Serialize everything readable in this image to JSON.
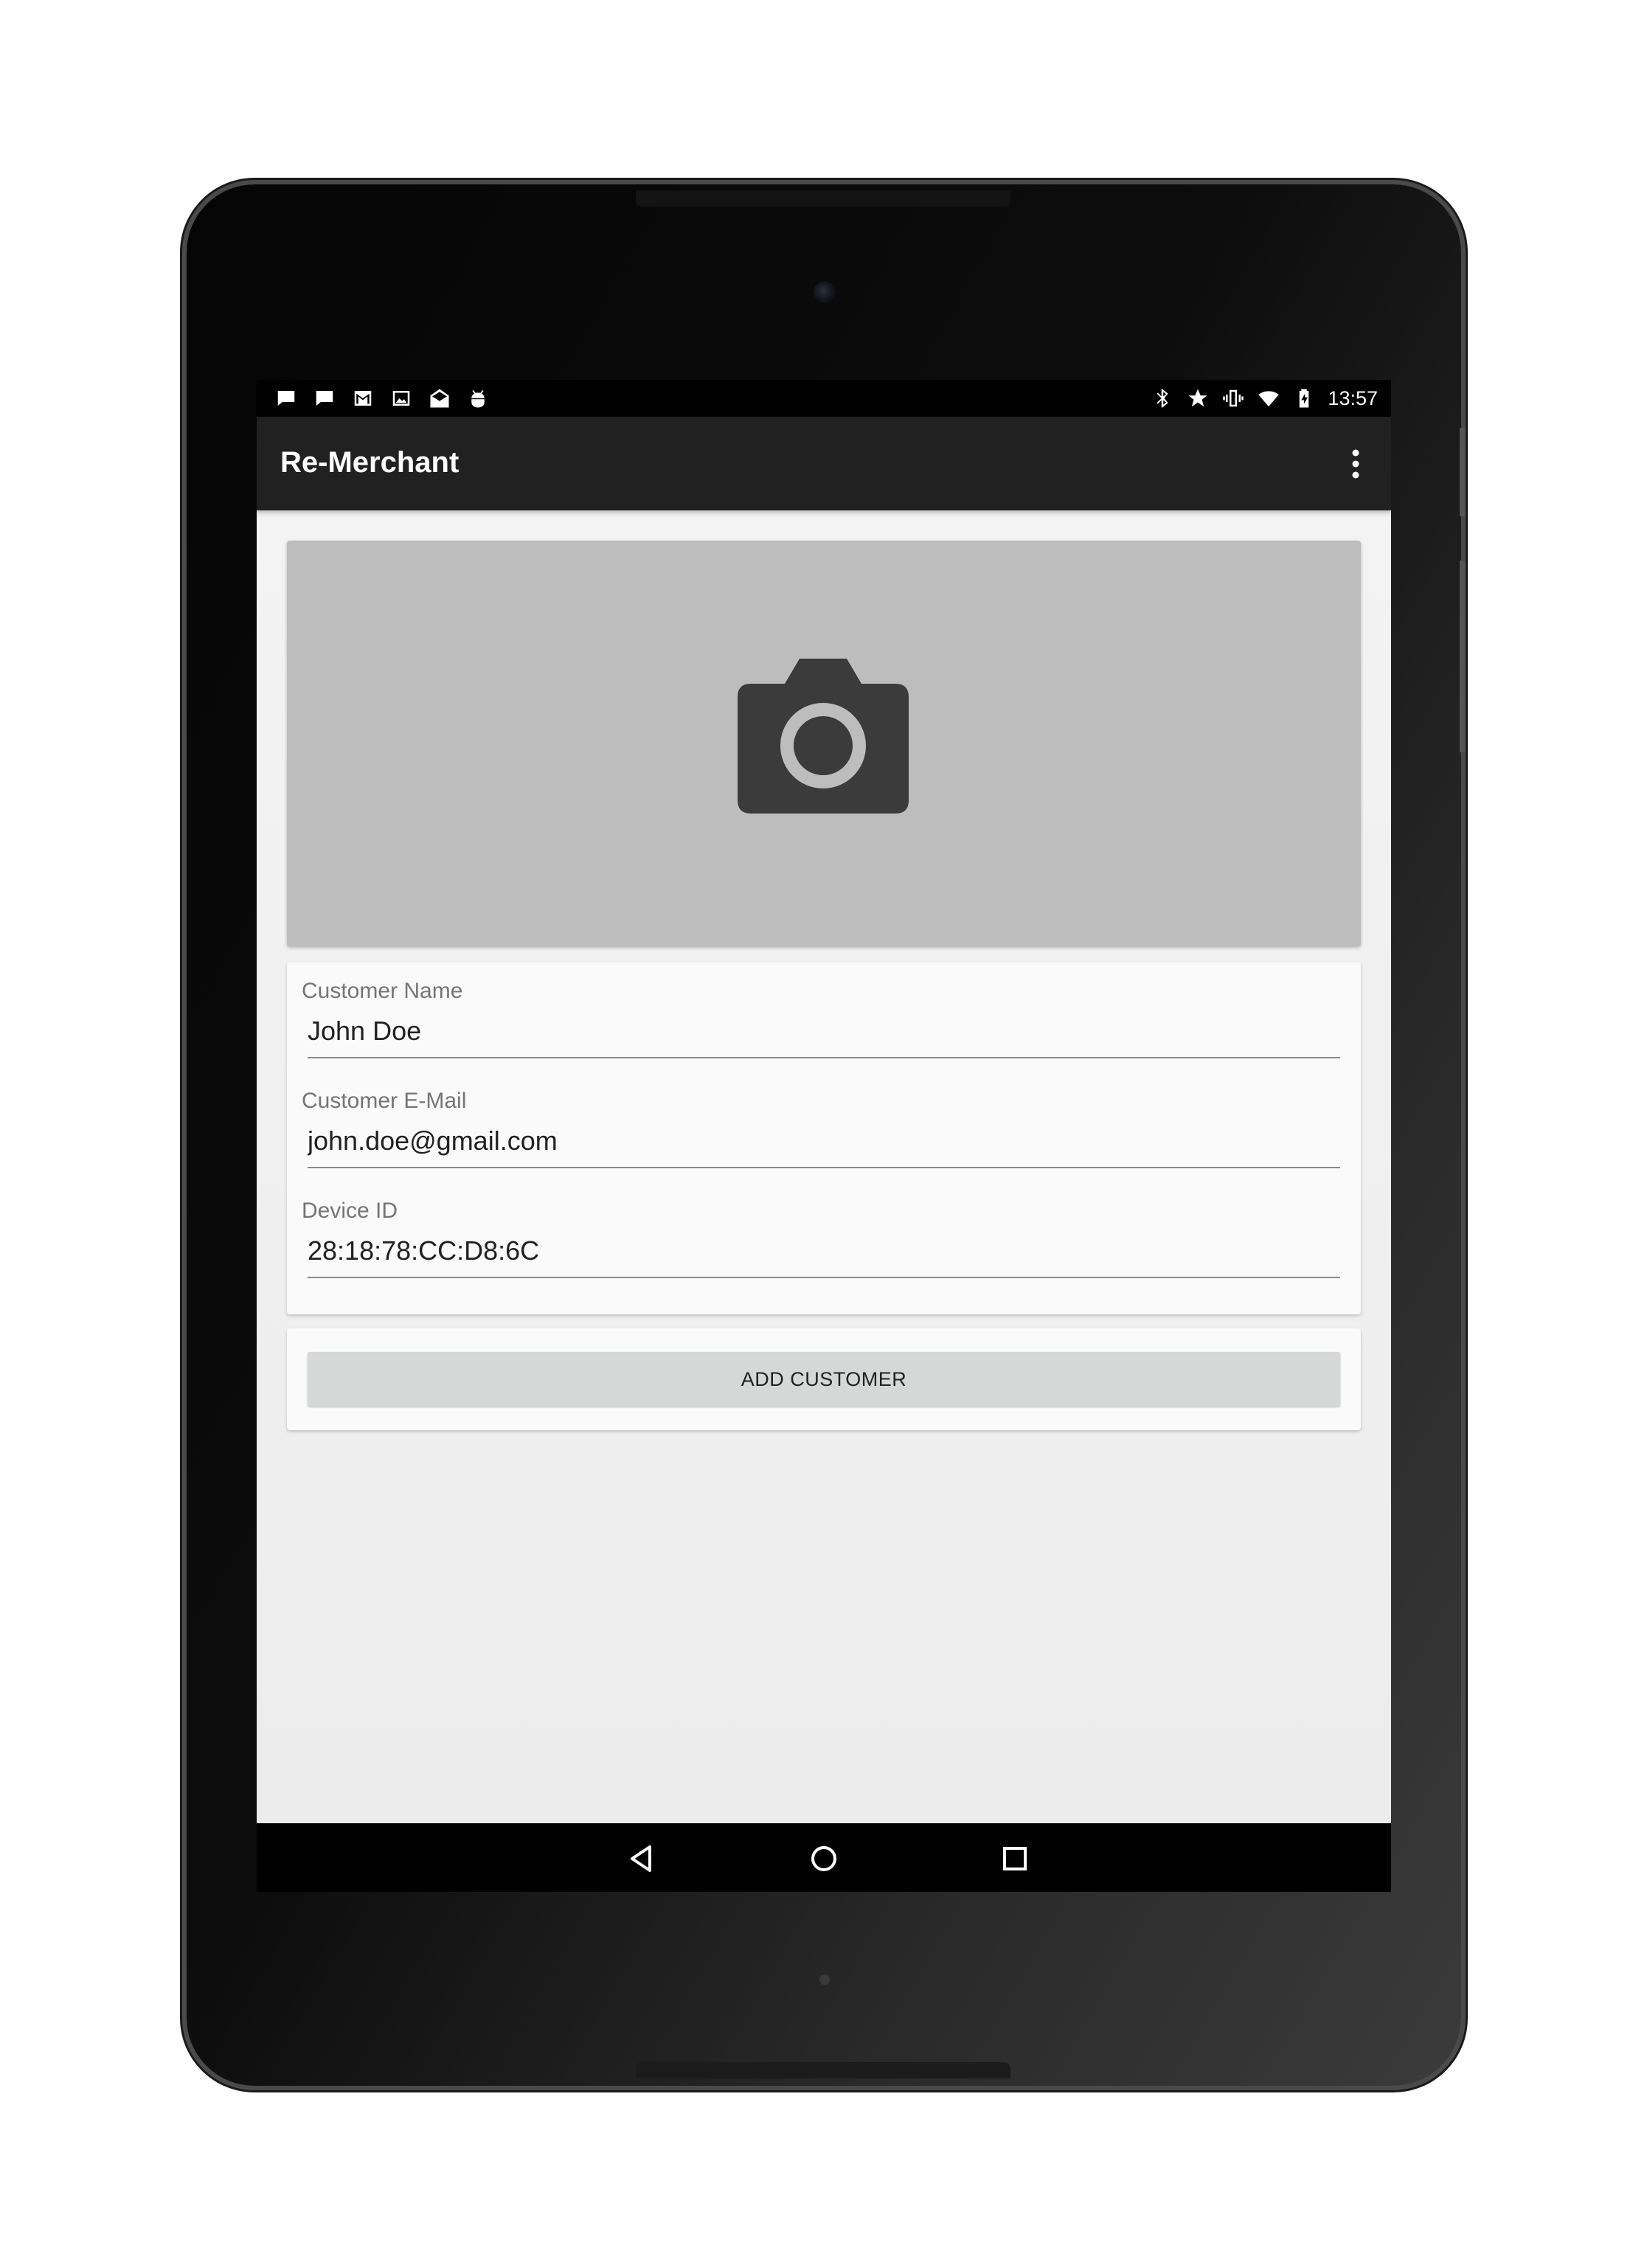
{
  "status_bar": {
    "left_icons": [
      "message-icon",
      "message-icon",
      "gmail-icon",
      "image-icon",
      "email-icon",
      "android-debug-icon"
    ],
    "right_icons": [
      "bluetooth-icon",
      "star-icon",
      "vibrate-icon",
      "wifi-icon",
      "battery-charging-icon"
    ],
    "time": "13:57"
  },
  "app_bar": {
    "title": "Re-Merchant",
    "overflow_icon": "more-vert-icon"
  },
  "photo": {
    "icon": "camera-icon",
    "background": "#bdbdbd"
  },
  "form": {
    "fields": [
      {
        "label": "Customer Name",
        "value": "John Doe"
      },
      {
        "label": "Customer E-Mail",
        "value": "john.doe@gmail.com"
      },
      {
        "label": "Device ID",
        "value": "28:18:78:CC:D8:6C"
      }
    ]
  },
  "actions": {
    "add_customer_label": "ADD CUSTOMER"
  },
  "nav_bar": {
    "icons": [
      "back-icon",
      "home-icon",
      "recents-icon"
    ]
  },
  "colors": {
    "app_bar": "#212121",
    "status_bar": "#000000",
    "button": "#d6d7d7",
    "content_bg": "#ededed"
  }
}
